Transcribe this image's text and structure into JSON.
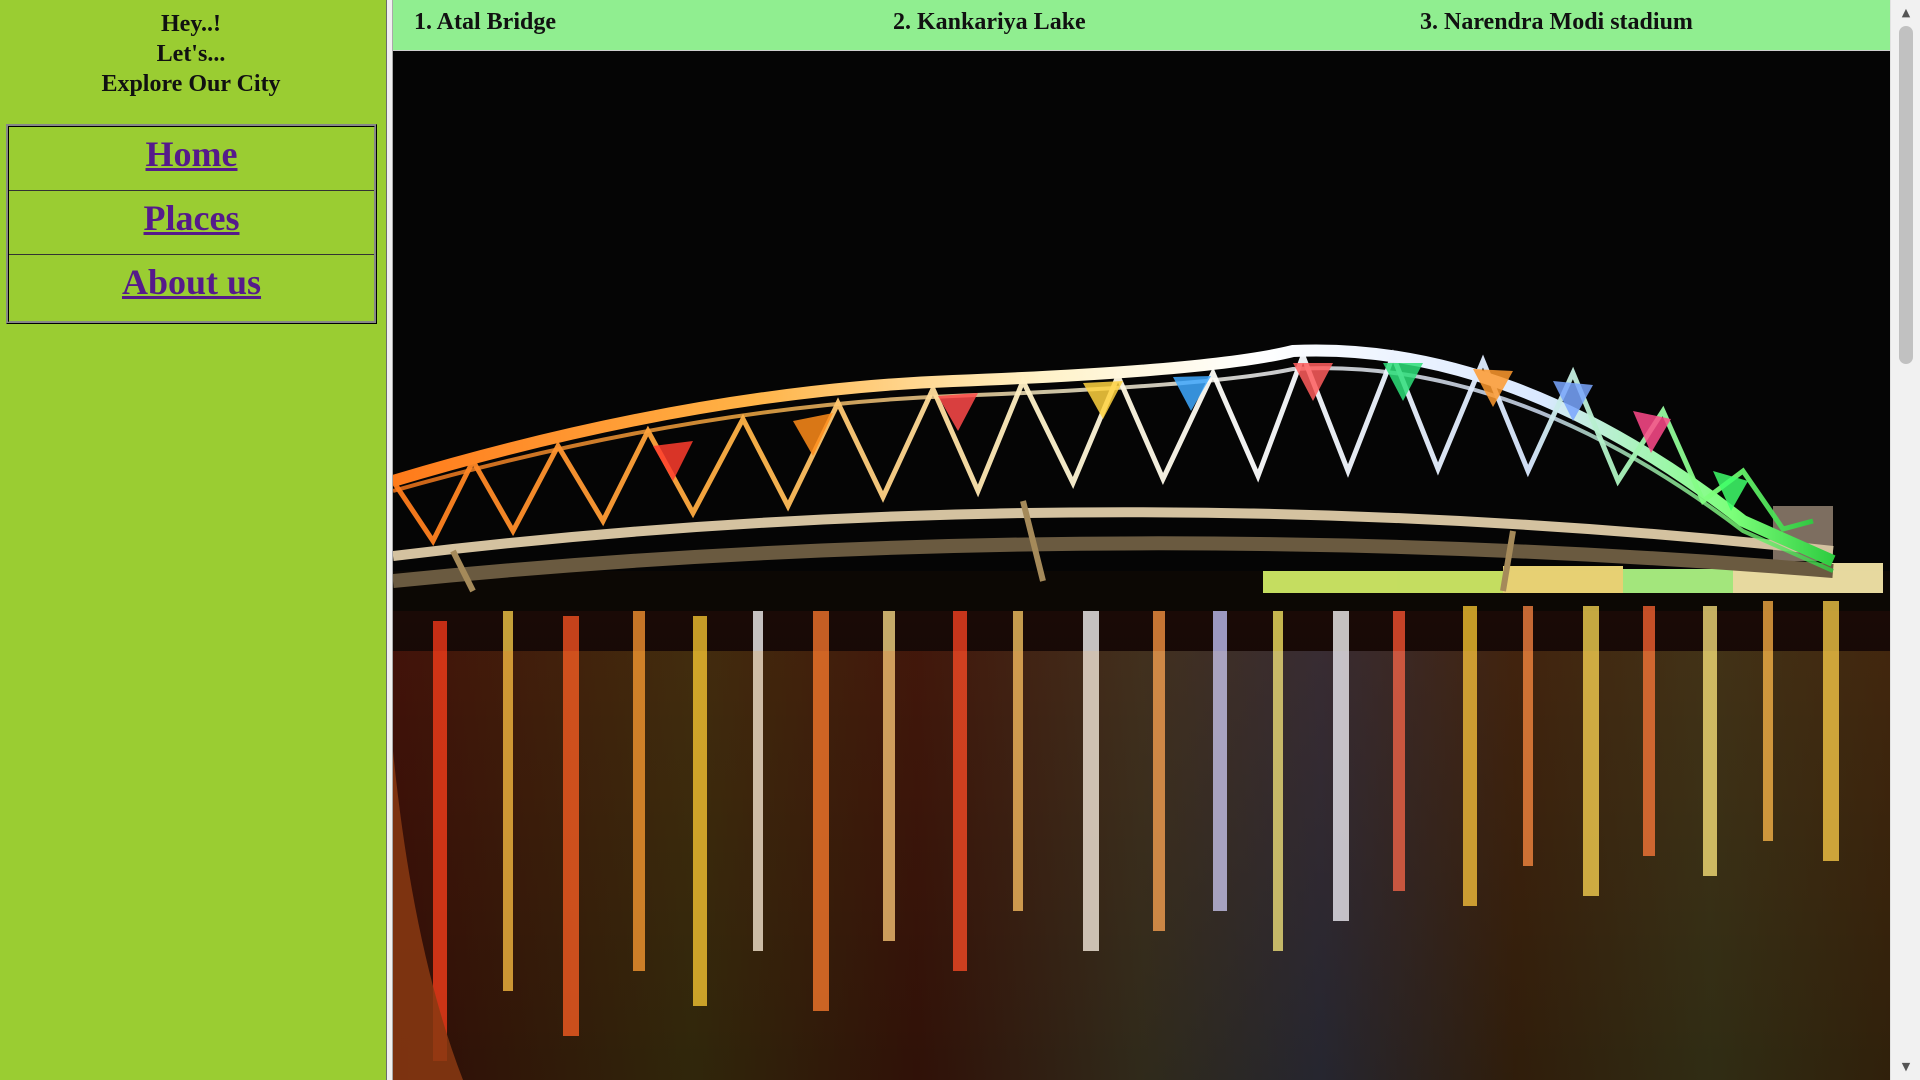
{
  "sidebar": {
    "greeting_line1": "Hey..!",
    "greeting_line2": "Let's...",
    "greeting_line3": "Explore Our City",
    "nav": [
      {
        "label": "Home"
      },
      {
        "label": "Places"
      },
      {
        "label": "About us"
      }
    ]
  },
  "topbar": {
    "places": [
      {
        "label": "1. Atal Bridge"
      },
      {
        "label": "2. Kankariya Lake"
      },
      {
        "label": "3. Narendra Modi stadium"
      }
    ]
  },
  "main": {
    "photo_subject": "Atal Bridge illuminated at night over river"
  },
  "scrollbar": {
    "up_icon": "▲",
    "down_icon": "▼"
  },
  "colors": {
    "sidebar_bg": "#9acd32",
    "topbar_bg": "#90ee90",
    "link_visited": "#551a8b"
  }
}
